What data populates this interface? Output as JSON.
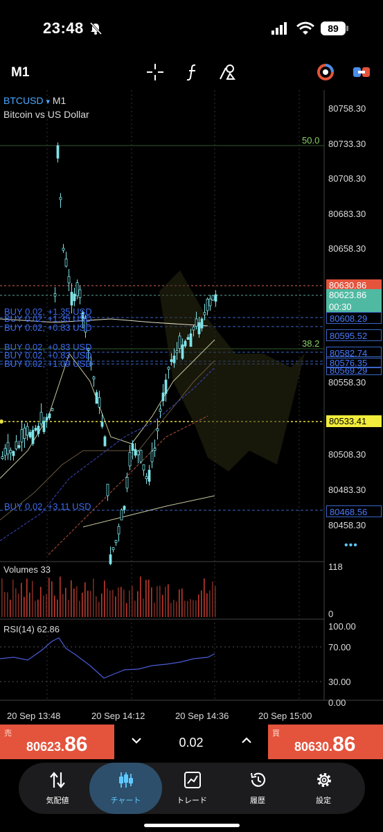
{
  "status": {
    "time": "23:48",
    "battery": "89"
  },
  "toolbar": {
    "timeframe": "M1"
  },
  "chart": {
    "symbol": "BTCUSD",
    "symbol_arrow": "▾",
    "symbol_timeframe": "M1",
    "description": "Bitcoin vs US Dollar",
    "price_axis": [
      "80758.30",
      "80733.30",
      "80708.30",
      "80683.30",
      "80658.30",
      "80558.30",
      "80508.30",
      "80483.30",
      "80458.30"
    ],
    "price_labels": {
      "ask": "80630.86",
      "bid": "80623.86",
      "countdown": "00:30",
      "l1": "80608.29",
      "l2": "80595.52",
      "l3": "80582.74",
      "l4": "80576.35",
      "l5": "80569.29",
      "level": "80533.41",
      "l6": "80468.56"
    },
    "fib": {
      "f50": "50.0",
      "f382": "38.2"
    },
    "orders": {
      "o1": "BUY 0.02, +1.35 USD",
      "o2": "BUY 0.02, +1.35 USD",
      "o3": "BUY 0.02, +0.83 USD",
      "o4": "BUY 0.02, +0.83 USD",
      "o5": "BUY 0.02, +0.83 USD",
      "o6": "BUY 0.02, +1.09 USD",
      "o7": "BUY 0.02, +3.11 USD"
    },
    "more": "•••",
    "volumes": {
      "label": "Volumes 33",
      "max": "118",
      "min": "0"
    },
    "rsi": {
      "label": "RSI(14) 62.86",
      "l100": "100.00",
      "l70": "70.00",
      "l30": "30.00",
      "l0": "0.00"
    },
    "time_axis": [
      "20 Sep 13:48",
      "20 Sep 14:12",
      "20 Sep 14:36",
      "20 Sep 15:00"
    ]
  },
  "trade": {
    "sell_label": "売",
    "sell_price_small": "80623.",
    "sell_price_big": "86",
    "volume": "0.02",
    "buy_label": "買",
    "buy_price_small": "80630.",
    "buy_price_big": "86"
  },
  "nav": {
    "quotes": "気配値",
    "chart": "チャート",
    "trade": "トレード",
    "history": "履歴",
    "settings": "設定"
  },
  "colors": {
    "sell": "#e4533c",
    "buy": "#e4533c",
    "candle": "#7fe3e8",
    "fib": "#3a6b30",
    "accent": "#5ec8ff"
  }
}
